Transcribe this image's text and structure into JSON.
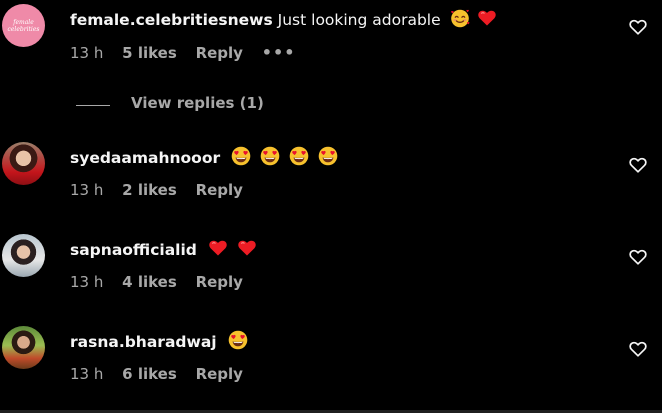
{
  "comments": [
    {
      "avatar_text": "female celebrities",
      "username": "female.celebritiesnews",
      "text": "Just looking adorable",
      "emojis": [
        "smiling-face-with-hearts",
        "red-heart"
      ],
      "time": "13 h",
      "likes": "5 likes",
      "reply": "Reply",
      "more": "•••",
      "view_replies": "View replies (1)"
    },
    {
      "username": "syedaamahnooor",
      "text": "",
      "emojis": [
        "heart-eyes",
        "heart-eyes",
        "heart-eyes",
        "heart-eyes"
      ],
      "time": "13 h",
      "likes": "2 likes",
      "reply": "Reply"
    },
    {
      "username": "sapnaofficialid",
      "text": "",
      "emojis": [
        "red-heart",
        "red-heart"
      ],
      "time": "13 h",
      "likes": "4 likes",
      "reply": "Reply"
    },
    {
      "username": "rasna.bharadwaj",
      "text": "",
      "emojis": [
        "heart-eyes"
      ],
      "time": "13 h",
      "likes": "6 likes",
      "reply": "Reply"
    }
  ],
  "colors": {
    "background": "#000000",
    "text": "#f5f5f5",
    "muted": "#a8a8a8",
    "heart": "#ed1c24",
    "emoji_yellow": "#f7c12d"
  }
}
